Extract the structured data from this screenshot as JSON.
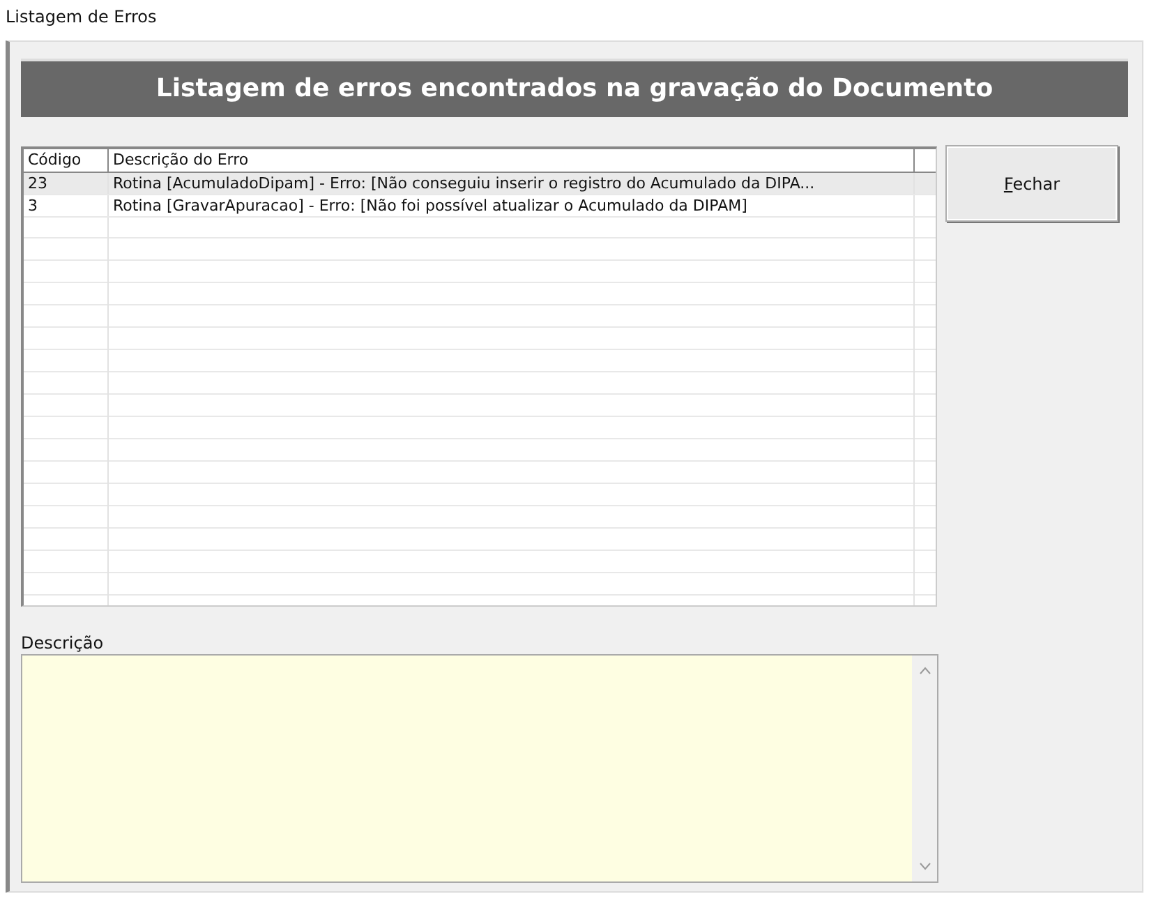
{
  "window": {
    "title": "Listagem de Erros"
  },
  "header": "Listagem de erros encontrados na gravação do Documento",
  "table": {
    "columns": [
      "Código",
      "Descrição do Erro"
    ],
    "rows": [
      {
        "code": "23",
        "description": "Rotina [AcumuladoDipam] - Erro: [Não conseguiu inserir o registro do Acumulado da DIPA...",
        "selected": true
      },
      {
        "code": "3",
        "description": "Rotina [GravarApuracao] - Erro: [Não foi possível atualizar o Acumulado da DIPAM]",
        "selected": false
      }
    ]
  },
  "close_button": "Fechar",
  "description": {
    "label": "Descrição"
  }
}
